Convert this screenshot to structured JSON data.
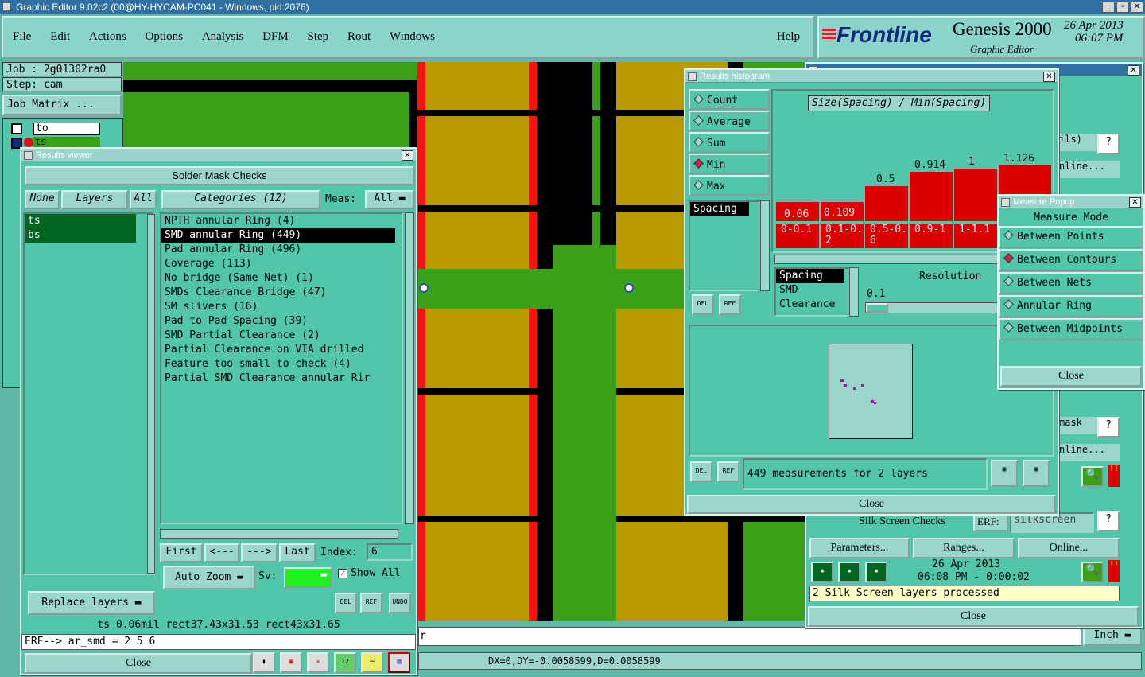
{
  "window": {
    "title": "Graphic Editor 9.02c2 (00@HY-HYCAM-PC041 - Windows, pid:2076)"
  },
  "menu": [
    "File",
    "Edit",
    "Actions",
    "Options",
    "Analysis",
    "DFM",
    "Step",
    "Rout",
    "Windows"
  ],
  "help": "Help",
  "brand": {
    "name": "Frontline",
    "product": "Genesis 2000",
    "subtitle": "Graphic Editor",
    "date": "26 Apr 2013",
    "time": "06:07 PM"
  },
  "job": {
    "job_label": "Job : 2g01302ra0",
    "step_label": "Step: cam",
    "matrix_button": "Job Matrix ..."
  },
  "layer_list": {
    "row1": "to",
    "row2": "ts"
  },
  "results_viewer": {
    "title": "Results viewer",
    "heading": "Solder Mask Checks",
    "none": "None",
    "layers": "Layers",
    "all": "All",
    "categories": "Categories (12)",
    "meas_label": "Meas:",
    "meas_value": "All",
    "layer_items": [
      "ts",
      "bs"
    ],
    "category_items": [
      "NPTH annular Ring (4)",
      "SMD annular Ring (449)",
      "Pad annular Ring (496)",
      "Coverage (113)",
      "No bridge (Same Net) (1)",
      "SMDs Clearance Bridge (47)",
      "SM slivers (16)",
      "Pad to Pad Spacing (39)",
      "SMD Partial Clearance (2)",
      "Partial Clearance on VIA drilled",
      "Feature too small to check (4)",
      "Partial SMD Clearance annular Rir"
    ],
    "first": "First",
    "prev": "<---",
    "next": "--->",
    "last": "Last",
    "index_label": "Index:",
    "index_value": "6",
    "auto_zoom": "Auto Zoom",
    "sv": "Sv:",
    "show_all": "Show All",
    "replace_layers": "Replace layers",
    "del": "DEL",
    "ref": "REF",
    "undo": "UNDO",
    "status": "ts 0.06mil  rect37.43x31.53  rect43x31.65",
    "erf": "ERF--> ar_smd = 2 5 6",
    "close": "Close"
  },
  "histogram": {
    "title": "Results histogram",
    "modes": [
      "Count",
      "Average",
      "Sum",
      "Min",
      "Max"
    ],
    "selected_mode": "Min",
    "axis_title": "Size(Spacing) / Min(Spacing)",
    "bar_values": [
      "0.06",
      "0.109",
      "0.5",
      "0.914",
      "1",
      "1.126"
    ],
    "bin_labels": [
      "0-0.1",
      "0.1-0.2",
      "0.5-0.6",
      "0.9-1",
      "1-1.1"
    ],
    "metric_list": [
      "Spacing"
    ],
    "sub_list": [
      "Spacing",
      "SMD",
      "Clearance"
    ],
    "resolution_label": "Resolution",
    "resolution_value": "0.1",
    "measurements": "449 measurements for 2 layers",
    "close": "Close"
  },
  "measure_popup": {
    "title": "Measure Popup",
    "heading": "Measure Mode",
    "options": [
      "Between Points",
      "Between Contours",
      "Between Nets",
      "Annular Ring",
      "Between Midpoints"
    ],
    "selected": "Between Contours",
    "close": "Close"
  },
  "checklist": {
    "row_labels": [
      "ils)",
      "nline...",
      "mask",
      "nline..."
    ],
    "silk_title": "Silk Screen Checks",
    "erf_label": "ERF:",
    "erf_value": "silkscreen",
    "parameters": "Parameters...",
    "ranges": "Ranges...",
    "online": "Online...",
    "date": "26 Apr 2013",
    "time": "06:08 PM - 0:00:02",
    "status": "2 Silk Screen layers processed",
    "close": "Close"
  },
  "bottom": {
    "coords": "DX=0,DY=-0.0058599,D=0.0058599",
    "units": "Inch",
    "prompt": "r"
  },
  "colors": {
    "copper": "#b89a00",
    "mask": "#ff1010",
    "board": "#3aa018",
    "bg": "#52c6ab",
    "title": "#3070a0"
  }
}
